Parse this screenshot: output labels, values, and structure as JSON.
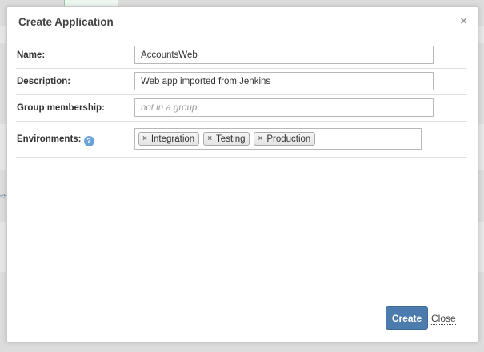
{
  "background": {
    "edge_text": "es"
  },
  "dialog": {
    "title": "Create Application",
    "close_icon": "×"
  },
  "form": {
    "name": {
      "label": "Name:",
      "value": "AccountsWeb"
    },
    "description": {
      "label": "Description:",
      "value": "Web app imported from Jenkins"
    },
    "group": {
      "label": "Group membership:",
      "value": "",
      "placeholder": "not in a group"
    },
    "environments": {
      "label": "Environments:",
      "help_icon": "?",
      "tags": [
        "Integration",
        "Testing",
        "Production"
      ],
      "remove_icon": "×"
    }
  },
  "actions": {
    "create_label": "Create",
    "close_label": "Close"
  },
  "colors": {
    "primary_button": "#4c7bae",
    "help_icon": "#6aa3d8",
    "overlay_background": "#dcdcdc"
  }
}
